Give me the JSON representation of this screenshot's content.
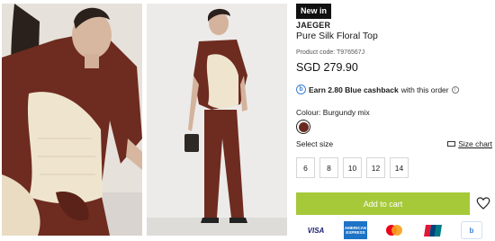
{
  "product": {
    "badge": "New in",
    "brand": "JAEGER",
    "name": "Pure Silk Floral Top",
    "code": "Product code: T976567J",
    "price": "SGD 279.90"
  },
  "cashback": {
    "icon": "b",
    "earn": "Earn 2.80 Blue cashback",
    "rest": "with this order",
    "info_icon": "i"
  },
  "colour": {
    "label": "Colour:",
    "value": "Burgundy mix",
    "swatch_color": "#6b2a20"
  },
  "size": {
    "label": "Select size",
    "chart_link": "Size chart",
    "options": [
      "6",
      "8",
      "10",
      "12",
      "14"
    ]
  },
  "cart": {
    "add_label": "Add to cart",
    "accent": "#a6c93a"
  },
  "payments": {
    "visa": "VISA",
    "amex": "AMERICAN EXPRESS",
    "blue_card": "b"
  },
  "icons": [
    "wishlist-heart-icon",
    "info-icon",
    "ruler-icon",
    "mastercard-icon",
    "unionpay-icon"
  ]
}
